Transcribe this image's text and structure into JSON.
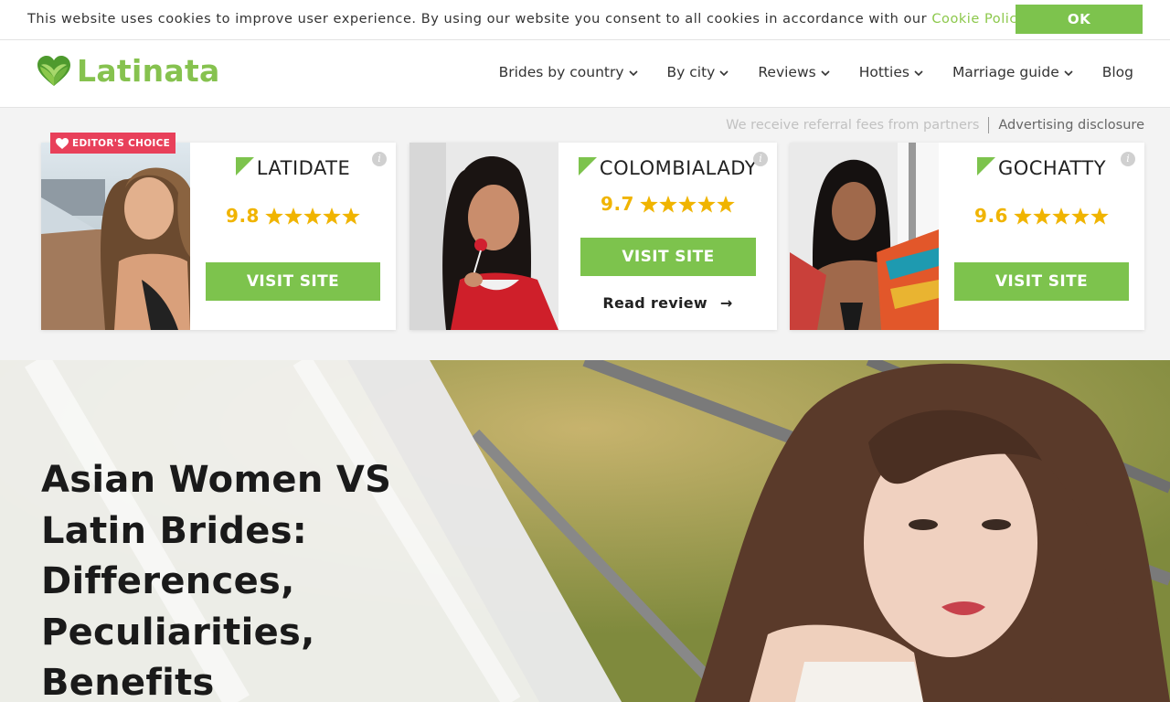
{
  "cookie": {
    "text": "This website uses cookies to improve user experience. By using our website you consent to all cookies in accordance with our",
    "link": "Cookie Policy",
    "ok": "OK"
  },
  "header": {
    "logo": "Latinata",
    "nav": [
      "Brides by country",
      "By city",
      "Reviews",
      "Hotties",
      "Marriage guide",
      "Blog"
    ]
  },
  "partners": {
    "referral": "We receive referral fees from partners",
    "disclosure": "Advertising disclosure",
    "badge": "EDITOR'S CHOICE",
    "cards": [
      {
        "name": "LATIDATE",
        "score": "9.8",
        "visit": "VISIT SITE"
      },
      {
        "name": "COLOMBIALADY",
        "score": "9.7",
        "visit": "VISIT SITE",
        "review": "Read review",
        "arrow": "→"
      },
      {
        "name": "GOCHATTY",
        "score": "9.6",
        "visit": "VISIT SITE"
      }
    ],
    "stars_per_card": 5,
    "info_icon": "i"
  },
  "hero": {
    "title": "Asian Women VS Latin Brides: Differences, Peculiarities, Benefits"
  },
  "colors": {
    "green": "#7dc34d",
    "logo_green": "#86c24f",
    "star_gold": "#f0b400",
    "badge_red": "#e8405a"
  }
}
